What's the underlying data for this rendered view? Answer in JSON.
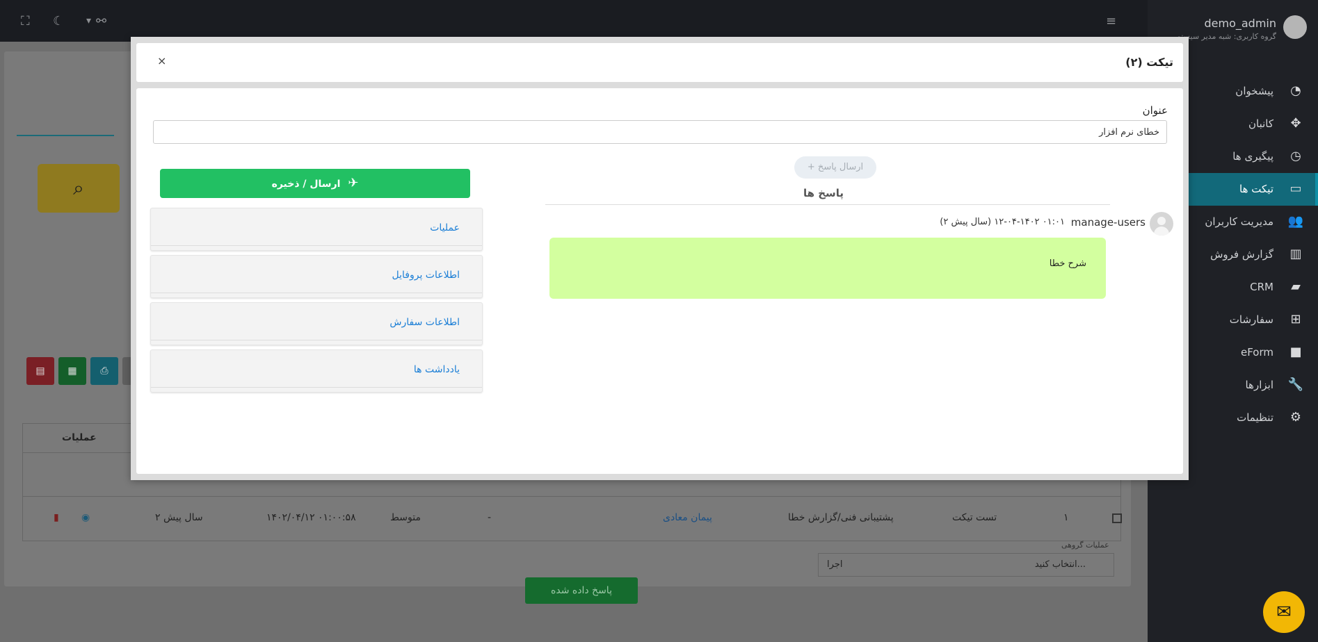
{
  "topbar": {
    "fullscreen_icon": "fullscreen-icon",
    "theme_icon": "moon-icon",
    "link_icon": "link-icon",
    "menu_icon": "hamburger-icon"
  },
  "sidebar": {
    "user": {
      "name": "demo_admin",
      "group": "گروه کاربری: شبه مدیر سیستم"
    },
    "items": [
      {
        "label": "پیشخوان",
        "icon": "dashboard-icon",
        "glyph": "◔",
        "active": false
      },
      {
        "label": "کانبان",
        "icon": "kanban-icon",
        "glyph": "✥",
        "active": false
      },
      {
        "label": "پیگیری ها",
        "icon": "clock-icon",
        "glyph": "◷",
        "active": false
      },
      {
        "label": "تیکت ها",
        "icon": "ticket-icon",
        "glyph": "▭",
        "active": true
      },
      {
        "label": "مدیریت کاربران",
        "icon": "users-icon",
        "glyph": "👥",
        "active": false
      },
      {
        "label": "گزارش فروش",
        "icon": "chart-icon",
        "glyph": "▥",
        "active": false
      },
      {
        "label": "CRM",
        "icon": "folder-open-icon",
        "glyph": "▰",
        "active": false
      },
      {
        "label": "سفارشات",
        "icon": "basket-icon",
        "glyph": "⊞",
        "active": false
      },
      {
        "label": "eForm",
        "icon": "folder-icon",
        "glyph": "■",
        "active": false
      },
      {
        "label": "ابزارها",
        "icon": "wrench-icon",
        "glyph": "🔧",
        "active": false
      },
      {
        "label": "تنظیمات",
        "icon": "gear-icon",
        "glyph": "⚙",
        "active": false
      }
    ]
  },
  "background_table": {
    "ops_header": "عملیات",
    "row": {
      "index": "۱",
      "title": "تست تیکت",
      "department": "پشتیبانی فنی/گزارش خطا",
      "user": "پیمان معادی",
      "status": "پاسخ داده شده",
      "dash": "-",
      "priority": "متوسط",
      "datetime": "۱۴۰۲/۰۴/۱۲ ۰۱:۰۰:۵۸",
      "age": "۲ سال پیش"
    },
    "group_ops_label": "عملیات گروهی",
    "group_select": "انتخاب کنید...",
    "run_button": "اجرا"
  },
  "modal": {
    "title": "تیکت (۲)",
    "close": "×",
    "subject_label": "عنوان",
    "subject_value": "خطای نرم افزار",
    "send_button": "ارسال / ذخیره",
    "reply_button": "+ ارسال پاسخ",
    "replies_title": "پاسخ ها",
    "panels": [
      "عملیات",
      "اطلاعات پروفایل",
      "اطلاعات سفارش",
      "یادداشت ها"
    ],
    "reply": {
      "author": "manage-users",
      "date": "(سال پیش ۲) ۰۱:۰۱ ۱۴۰۲-۰۴-۱۲",
      "message": "شرح خطا"
    }
  },
  "colors": {
    "sidebar_bg": "#1f2126",
    "active_item": "#12697a",
    "send_green": "#22c063",
    "reply_bg": "#d3ff9f",
    "link_blue": "#1c7fd6"
  }
}
